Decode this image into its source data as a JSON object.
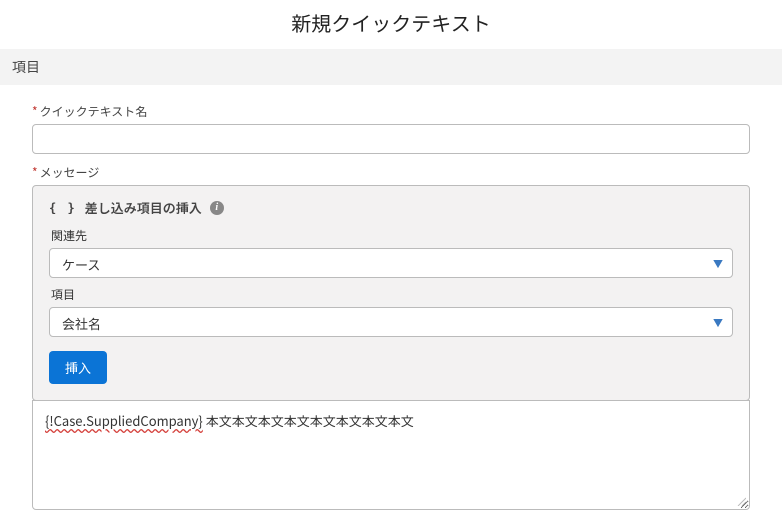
{
  "page": {
    "title": "新規クイックテキスト"
  },
  "section": {
    "heading": "項目"
  },
  "labels": {
    "required_mark": "*",
    "quick_text_name": "クイックテキスト名",
    "message": "メッセージ"
  },
  "merge_panel": {
    "brackets": "{ }",
    "title": "差し込み項目の挿入",
    "info_icon": "i",
    "related_to_label": "関連先",
    "related_to_value": "ケース",
    "field_label": "項目",
    "field_value": "会社名",
    "insert_button": "挿入"
  },
  "message_body": {
    "merge_token": "{!Case.SuppliedCompany}",
    "text_after": " 本文本文本文本文本文本文本文本文"
  },
  "fields": {
    "quick_text_name_value": ""
  }
}
